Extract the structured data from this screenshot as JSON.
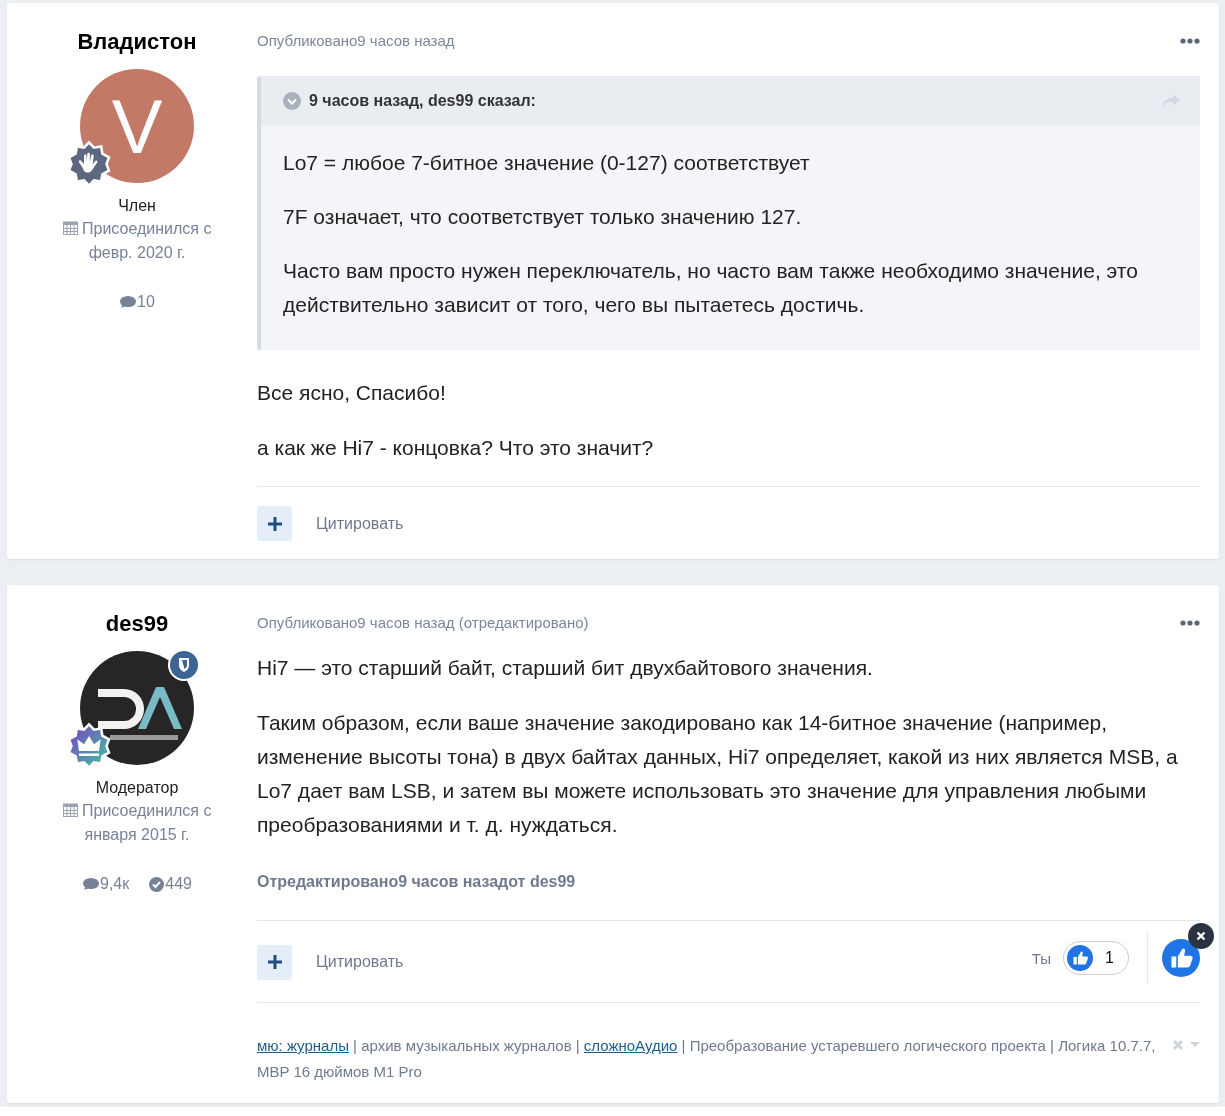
{
  "posts": [
    {
      "author": {
        "name": "Владистон",
        "avatar": {
          "kind": "letter",
          "letter": "V",
          "color": "#c27a66"
        },
        "badge": {
          "kind": "hand"
        },
        "moderator": false,
        "role": "Член",
        "joined": "Присоединился с февр. 2020 г.",
        "stats": [
          {
            "kind": "posts",
            "value": "10"
          }
        ]
      },
      "posted": "Опубликовано9 часов назад",
      "quote": {
        "header": "9 часов назад, des99 сказал:",
        "paragraphs": [
          "Lo7 = любое 7-битное значение (0-127) соответствует",
          "7F означает, что соответствует только значению 127.",
          "Часто вам просто нужен переключатель, но часто вам также необходимо значение, это действительно зависит от того, чего вы пытаетесь достичь."
        ]
      },
      "paragraphs": [
        "Все ясно, Спасибо!",
        "а как же Hi7 - концовка? Что это значит?"
      ],
      "quote_label": "Цитировать"
    },
    {
      "author": {
        "name": "des99",
        "badge": {
          "kind": "crown"
        },
        "moderator": true,
        "role": "Модератор",
        "joined": "Присоединился с января 2015 г.",
        "stats": [
          {
            "kind": "posts",
            "value": "9,4к"
          },
          {
            "kind": "reputation",
            "value": "449"
          }
        ]
      },
      "posted": "Опубликовано9 часов назад (отредактировано)",
      "paragraphs": [
        "Hi7 — это старший байт, старший бит двухбайтового значения.",
        "Таким образом, если ваше значение закодировано как 14-битное значение (например, изменение высоты тона) в двух байтах данных, Hi7 определяет, какой из них является MSB, а Lo7 дает вам LSB, и затем вы можете использовать это значение для управления любыми преобразованиями и т. д. нуждаться."
      ],
      "edited": "Отредактировано9 часов назадот des99",
      "quote_label": "Цитировать",
      "reactions": {
        "you_label": "Ты",
        "count": "1"
      },
      "signature": [
        {
          "kind": "link",
          "text": "мю: журналы"
        },
        {
          "kind": "text",
          "text": " | архив музыкальных журналов | "
        },
        {
          "kind": "link",
          "text": "сложноАудио"
        },
        {
          "kind": "text",
          "text": " | Преобразование устаревшего логического проекта | Логика 10.7.7, MBP 16 дюймов M1 Pro"
        }
      ]
    }
  ]
}
